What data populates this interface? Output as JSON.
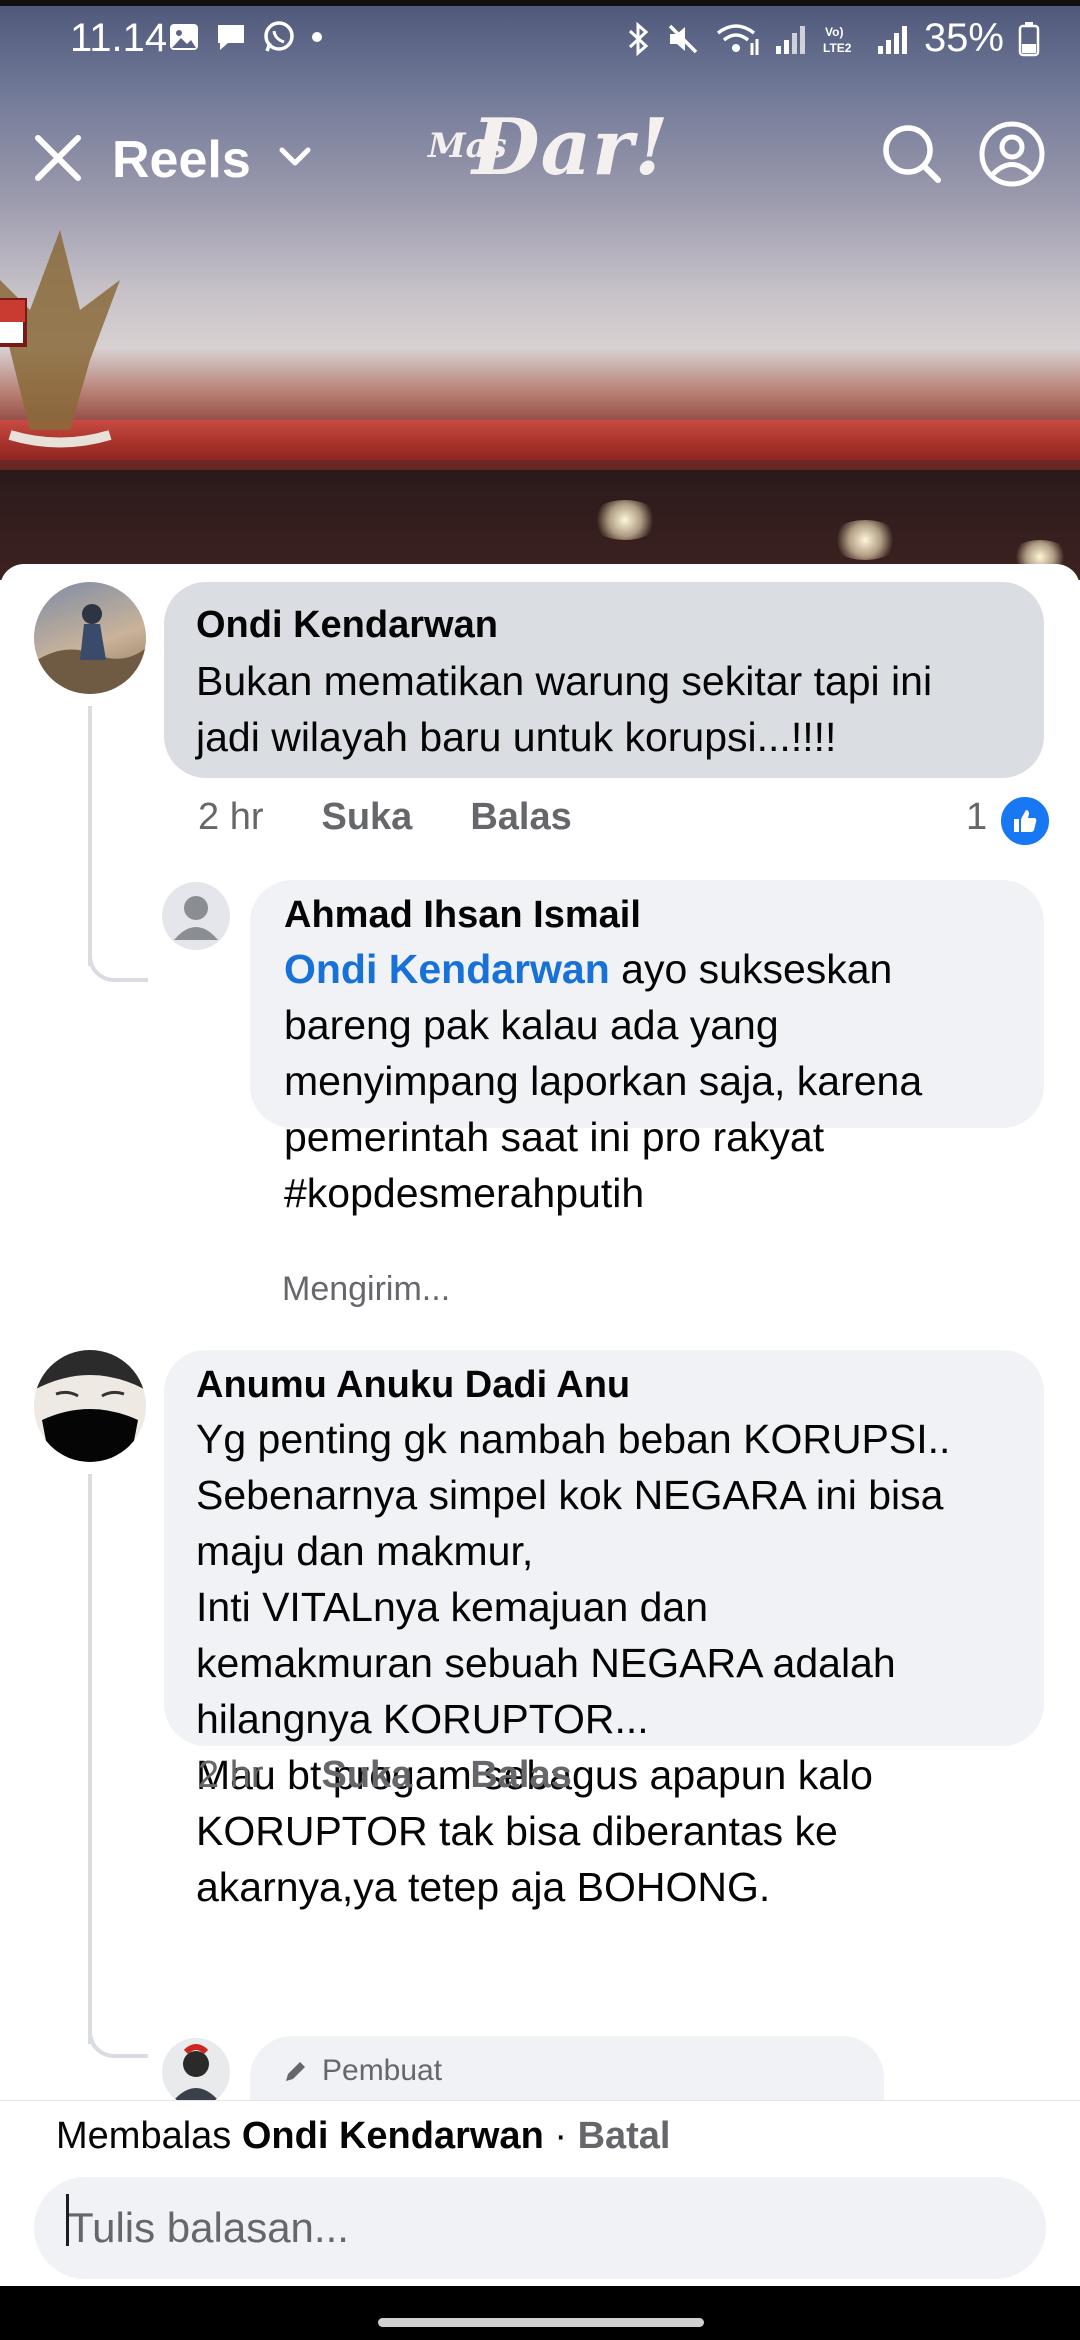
{
  "status_bar": {
    "time": "11.14",
    "battery": "35%",
    "left_icons": [
      "gallery-icon",
      "chat-bubble-icon",
      "whatsapp-icon",
      "dot-icon"
    ],
    "right_icons": [
      "bluetooth-icon",
      "mute-icon",
      "wifi-icon",
      "signal-icon",
      "volte-icon",
      "signal-icon",
      "battery-icon"
    ]
  },
  "header": {
    "title": "Reels",
    "logo_small": "Mas",
    "logo_main": "Dar!"
  },
  "comments": [
    {
      "author": "Ondi Kendarwan",
      "text": "Bukan mematikan warung sekitar tapi ini\njadi wilayah baru untuk korupsi...!!!!",
      "time": "2 hr",
      "like_label": "Suka",
      "reply_label": "Balas",
      "reaction_count": "1",
      "replies": [
        {
          "author": "Ahmad Ihsan Ismail",
          "mention": "Ondi Kendarwan",
          "text": " ayo sukseskan\nbareng pak kalau ada yang\nmenyimpang laporkan saja, karena\npemerintah saat ini pro rakyat\n#kopdesmerahputih",
          "status": "Mengirim..."
        }
      ]
    },
    {
      "author": "Anumu Anuku Dadi Anu",
      "text": "Yg penting gk nambah beban KORUPSI..\nSebenarnya simpel kok NEGARA ini bisa\nmaju dan makmur,\nInti VITALnya kemajuan dan\nkemakmuran sebuah NEGARA adalah\nhilangnya KORUPTOR...\nMau bt progam sebagus apapun kalo\nKORUPTOR tak bisa diberantas ke\nakarnya,ya tetep aja BOHONG.",
      "time": "2 hr",
      "like_label": "Suka",
      "reply_label": "Balas",
      "replies": [
        {
          "badge": "Pembuat"
        }
      ]
    }
  ],
  "composer": {
    "replying_prefix": "Membalas",
    "replying_to": "Ondi Kendarwan",
    "separator": "·",
    "cancel": "Batal",
    "placeholder": "Tulis balasan..."
  },
  "colors": {
    "accent": "#1877f2",
    "mention": "#1771d8",
    "bubble": "#f0f2f5",
    "bubble_active": "#dadde1",
    "secondary_text": "#65676b"
  }
}
